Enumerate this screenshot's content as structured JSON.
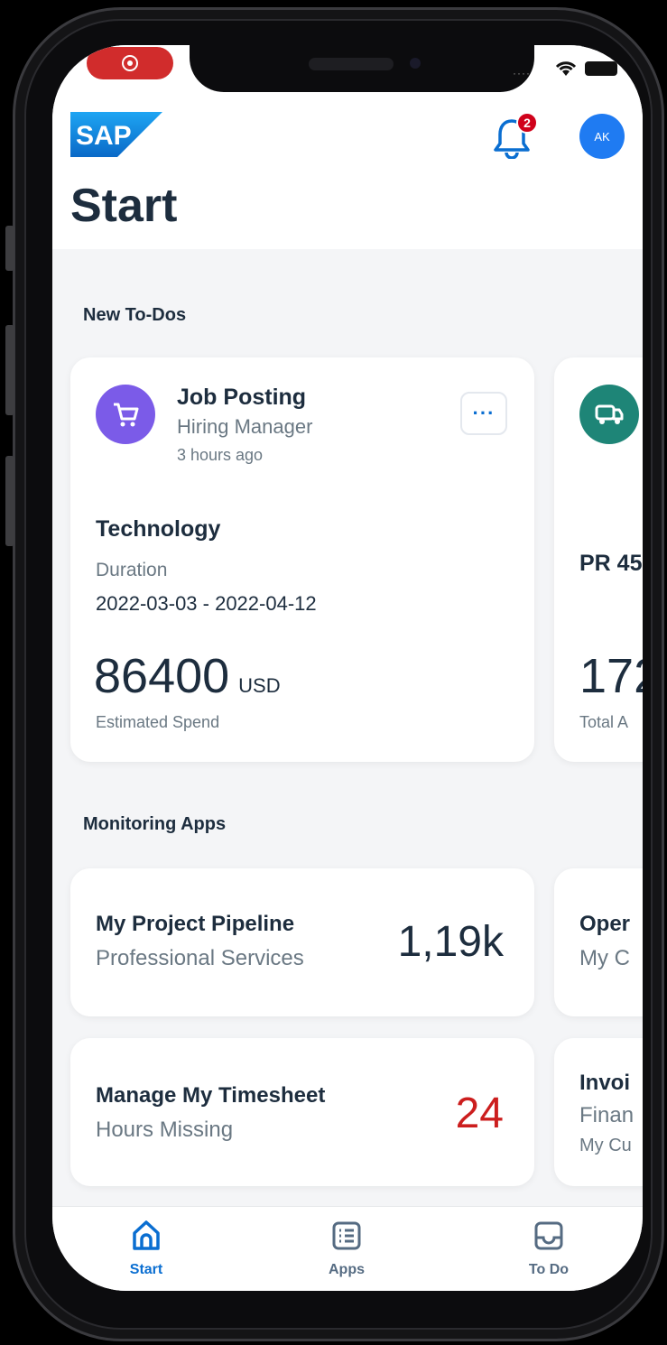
{
  "header": {
    "logo_text": "SAP",
    "notification_count": "2",
    "avatar_initials": "AK",
    "page_title": "Start"
  },
  "todos": {
    "section_title": "New To-Dos",
    "cards": [
      {
        "title": "Job Posting",
        "subtitle": "Hiring Manager",
        "time": "3 hours ago",
        "category": "Technology",
        "duration_label": "Duration",
        "duration": "2022-03-03 - 2022-04-12",
        "amount": "86400",
        "currency": "USD",
        "amount_label": "Estimated Spend",
        "icon": "cart-icon",
        "icon_color": "#7b5be8"
      },
      {
        "category": "PR 45",
        "amount": "172",
        "amount_label": "Total A",
        "icon": "truck-icon",
        "icon_color": "#1e8577"
      }
    ],
    "more_label": "···"
  },
  "monitoring": {
    "section_title": "Monitoring Apps",
    "cards": [
      {
        "title": "My Project Pipeline",
        "subtitle": "Professional Services",
        "value": "1,19k"
      },
      {
        "title": "Oper",
        "subtitle": "My C"
      },
      {
        "title": "Manage My Timesheet",
        "subtitle": "Hours Missing",
        "value": "24",
        "value_color": "#cc1e1e"
      },
      {
        "title": "Invoi",
        "subtitle": "Finan",
        "subtitle2": "My Cu"
      }
    ]
  },
  "tabbar": {
    "tabs": [
      {
        "label": "Start",
        "icon": "home-icon",
        "active": true
      },
      {
        "label": "Apps",
        "icon": "apps-list-icon",
        "active": false
      },
      {
        "label": "To Do",
        "icon": "inbox-icon",
        "active": false
      }
    ],
    "active_color": "#0a6ed1",
    "inactive_color": "#556b82"
  }
}
